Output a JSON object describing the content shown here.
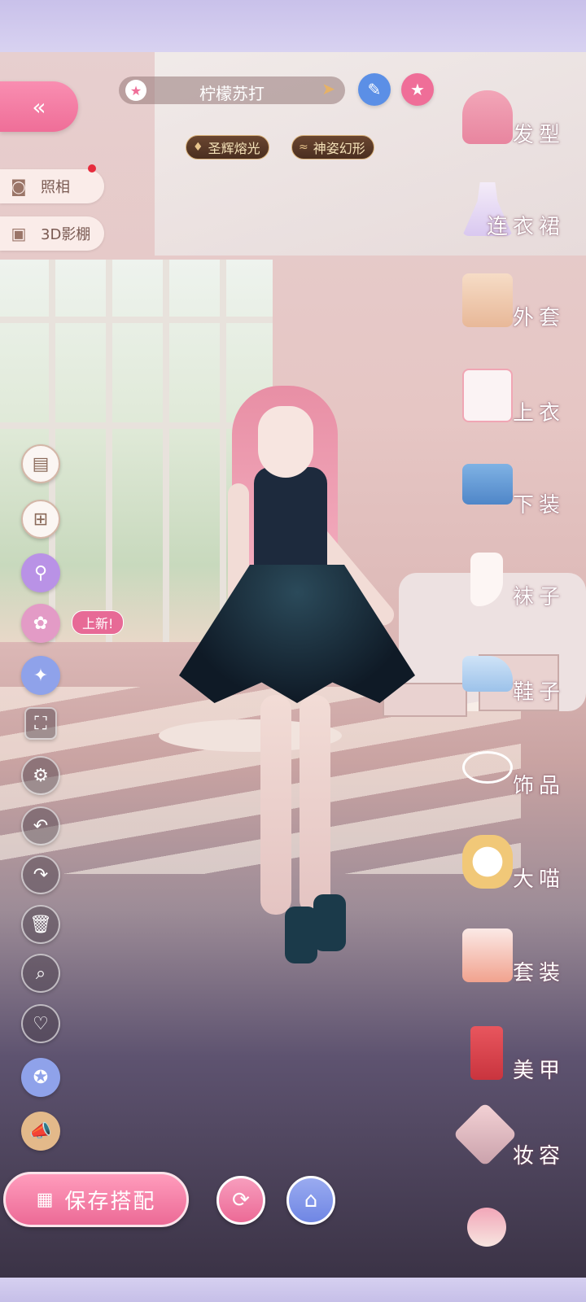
{
  "outfit": {
    "name": "柠檬苏打"
  },
  "chips": [
    "圣辉熔光",
    "神姿幻形"
  ],
  "side_buttons": {
    "photo": "照相",
    "studio": "3D影棚"
  },
  "new_badge": "上新!",
  "categories": [
    "发型",
    "连衣裙",
    "外套",
    "上衣",
    "下装",
    "袜子",
    "鞋子",
    "饰品",
    "大喵",
    "套装",
    "美甲",
    "妆容"
  ],
  "save_button": "保存搭配",
  "colors": {
    "accent_pink": "#ef6e98",
    "gold": "#e6b266",
    "tool_blue": "#8fa2ea"
  },
  "icons": {
    "back": "double-chevron-left-icon",
    "star": "star-icon",
    "pen": "pen-icon",
    "camera": "camera-icon",
    "cube": "cube-icon"
  }
}
